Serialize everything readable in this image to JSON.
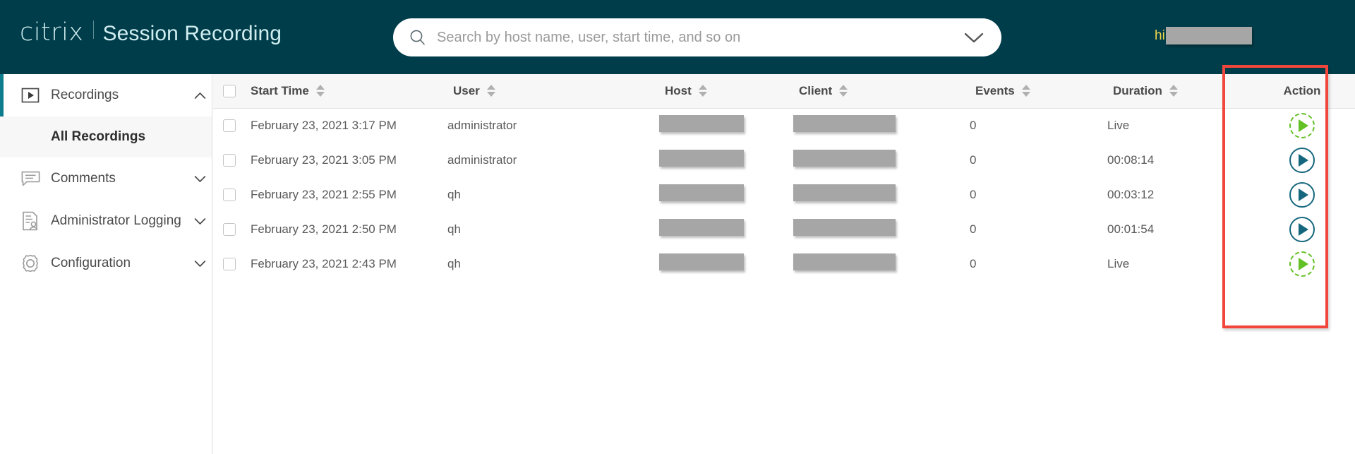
{
  "header": {
    "brand_name": "citrix",
    "app_title": "Session Recording",
    "separator": "|",
    "search": {
      "placeholder": "Search by host name, user, start time, and so on",
      "value": "",
      "search_icon": "search-icon",
      "chevron_icon": "chevron-down-icon"
    },
    "user": {
      "greeting": "hi",
      "name_redacted": true
    },
    "background_color": "#003D4A",
    "brand_text_color": "#CFEDEF",
    "greeting_color": "#F2D54A"
  },
  "sidebar": {
    "items": [
      {
        "label": "Recordings",
        "icon": "play-box-icon",
        "caret": "chevron-up-icon",
        "expanded": true,
        "active": true
      },
      {
        "label": "Comments",
        "icon": "comment-icon",
        "caret": "chevron-down-icon",
        "expanded": false,
        "active": false
      },
      {
        "label": "Administrator Logging",
        "icon": "log-user-icon",
        "caret": "chevron-down-icon",
        "expanded": false,
        "active": false
      },
      {
        "label": "Configuration",
        "icon": "gear-icon",
        "caret": "chevron-down-icon",
        "expanded": false,
        "active": false
      }
    ],
    "sub_items": [
      {
        "label": "All Recordings",
        "parent": "Recordings",
        "selected": true
      }
    ],
    "active_indicator_color": "#0D7C8C"
  },
  "table": {
    "columns": [
      {
        "key": "start_time",
        "label": "Start Time",
        "sortable": true,
        "align": "left"
      },
      {
        "key": "user",
        "label": "User",
        "sortable": true,
        "align": "left"
      },
      {
        "key": "host",
        "label": "Host",
        "sortable": true,
        "align": "left"
      },
      {
        "key": "client",
        "label": "Client",
        "sortable": true,
        "align": "left"
      },
      {
        "key": "events",
        "label": "Events",
        "sortable": true,
        "align": "left"
      },
      {
        "key": "duration",
        "label": "Duration",
        "sortable": true,
        "align": "left"
      },
      {
        "key": "action",
        "label": "Action",
        "sortable": false,
        "align": "center"
      }
    ],
    "select_all_checked": false,
    "rows": [
      {
        "selected": false,
        "start_time": "February 23, 2021 3:17 PM",
        "user": "administrator",
        "host_redacted": true,
        "client_redacted": true,
        "events": "0",
        "duration": "Live",
        "duration_is_live": true,
        "action_icon": "play-live-icon"
      },
      {
        "selected": false,
        "start_time": "February 23, 2021 3:05 PM",
        "user": "administrator",
        "host_redacted": true,
        "client_redacted": true,
        "events": "0",
        "duration": "00:08:14",
        "duration_is_live": false,
        "action_icon": "play-icon"
      },
      {
        "selected": false,
        "start_time": "February 23, 2021 2:55 PM",
        "user": "qh",
        "host_redacted": true,
        "client_redacted": true,
        "events": "0",
        "duration": "00:03:12",
        "duration_is_live": false,
        "action_icon": "play-icon"
      },
      {
        "selected": false,
        "start_time": "February 23, 2021 2:50 PM",
        "user": "qh",
        "host_redacted": true,
        "client_redacted": true,
        "events": "0",
        "duration": "00:01:54",
        "duration_is_live": false,
        "action_icon": "play-icon"
      },
      {
        "selected": false,
        "start_time": "February 23, 2021 2:43 PM",
        "user": "qh",
        "host_redacted": true,
        "client_redacted": true,
        "events": "0",
        "duration": "Live",
        "duration_is_live": true,
        "action_icon": "play-live-icon"
      }
    ],
    "link_color": "#1B6D85",
    "live_accent_color": "#63C025",
    "play_accent_color": "#15677D"
  },
  "annotation": {
    "highlight_box_color": "#F2463C",
    "highlight_target": "Action"
  }
}
